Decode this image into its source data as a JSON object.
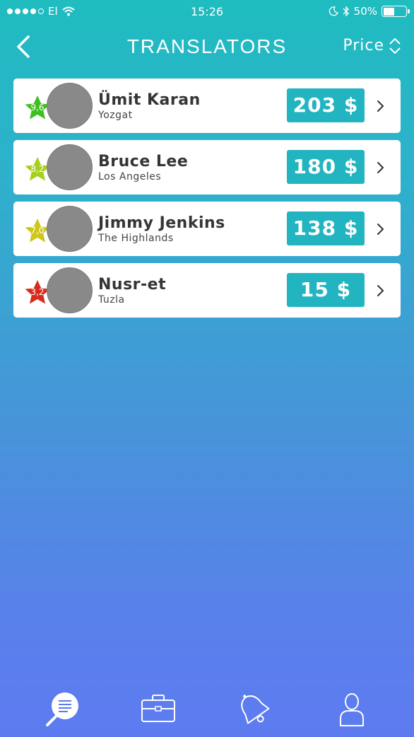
{
  "status_bar": {
    "carrier": "El",
    "time": "15:26",
    "battery_percent": "50%",
    "battery_level": 0.5,
    "signal_bars_filled": 4,
    "signal_bars_total": 5
  },
  "nav": {
    "title": "TRANSLATORS",
    "sort_label": "Price",
    "back_icon": "chevron-left-icon",
    "sort_icon": "sort-updown-icon"
  },
  "translators": [
    {
      "rating": "9,6",
      "rating_color": "#3ec01f",
      "name": "Ümit Karan",
      "city": "Yozgat",
      "price": "203 $"
    },
    {
      "rating": "8,2",
      "rating_color": "#a6cf1e",
      "name": "Bruce Lee",
      "city": "Los Angeles",
      "price": "180 $"
    },
    {
      "rating": "7,0",
      "rating_color": "#cfc61c",
      "name": "Jimmy Jenkins",
      "city": "The Highlands",
      "price": "138 $"
    },
    {
      "rating": "3,2",
      "rating_color": "#d62c1d",
      "name": "Nusr-et",
      "city": "Tuzla",
      "price": "15 $"
    }
  ],
  "tabs": [
    {
      "icon": "search-list-icon",
      "active": true
    },
    {
      "icon": "briefcase-icon",
      "active": false
    },
    {
      "icon": "bell-icon",
      "active": false
    },
    {
      "icon": "user-icon",
      "active": false
    }
  ],
  "colors": {
    "accent": "#22b4c0",
    "gradient_top": "#1fbcc0",
    "gradient_bottom": "#5d7bf0"
  }
}
